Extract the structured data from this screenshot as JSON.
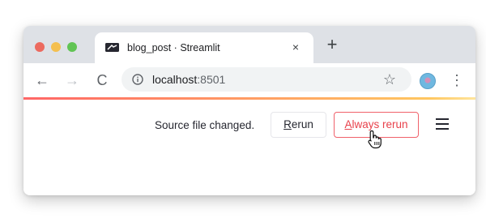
{
  "browser": {
    "tab": {
      "title": "blog_post · Streamlit",
      "close_glyph": "×",
      "favicon": "streamlit-logo-icon"
    },
    "new_tab_glyph": "+",
    "toolbar": {
      "back_glyph": "←",
      "forward_glyph": "→",
      "reload_glyph": "C",
      "url_host": "localhost",
      "url_port": ":8501",
      "star_glyph": "☆",
      "menu_glyph": "⋮"
    }
  },
  "streamlit": {
    "status_text": "Source file changed.",
    "rerun": {
      "accel": "R",
      "rest": "erun"
    },
    "always_rerun": {
      "accel": "A",
      "rest": "lways rerun"
    },
    "colors": {
      "accent": "#f0616b",
      "text": "#262730"
    }
  }
}
